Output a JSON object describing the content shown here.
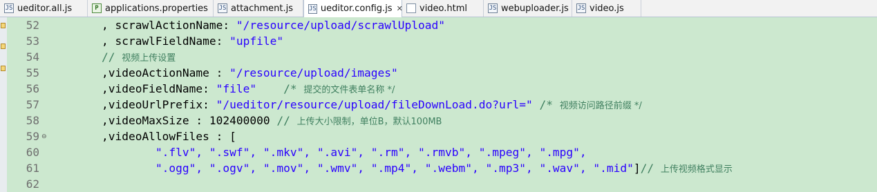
{
  "tabs": [
    {
      "label": "ueditor.all.js",
      "icon": "js-file-icon",
      "glyph": "JS",
      "active": false
    },
    {
      "label": "applications.properties",
      "icon": "properties-file-icon",
      "glyph": "P",
      "active": false
    },
    {
      "label": "attachment.js",
      "icon": "js-file-icon",
      "glyph": "JS",
      "active": false
    },
    {
      "label": "ueditor.config.js",
      "icon": "js-file-icon",
      "glyph": "JS",
      "active": true,
      "close": "✕"
    },
    {
      "label": "video.html",
      "icon": "html-file-icon",
      "glyph": "",
      "active": false
    },
    {
      "label": "webuploader.js",
      "icon": "js-file-icon",
      "glyph": "JS",
      "active": false
    },
    {
      "label": "video.js",
      "icon": "js-file-icon",
      "glyph": "JS",
      "active": false
    }
  ],
  "editor": {
    "lines": [
      {
        "num": "52",
        "a": "        , scrawlActionName: ",
        "s": "\"/resource/upload/scrawlUpload\"",
        "b": "",
        "c": "",
        "z": ""
      },
      {
        "num": "53",
        "a": "        , scrawlFieldName: ",
        "s": "\"upfile\"",
        "b": "",
        "c": "",
        "z": ""
      },
      {
        "num": "54",
        "a": "",
        "s": "",
        "b": "",
        "c": "        // ",
        "z": "视频上传设置"
      },
      {
        "num": "55",
        "a": "        ,videoActionName : ",
        "s": "\"/resource/upload/images\"",
        "b": "",
        "c": "",
        "z": ""
      },
      {
        "num": "56",
        "a": "        ,videoFieldName: ",
        "s": "\"file\"",
        "b": "",
        "c": "    /* ",
        "z": "提交的文件表单名称 */"
      },
      {
        "num": "57",
        "a": "        ,videoUrlPrefix: ",
        "s": "\"/ueditor/resource/upload/fileDownLoad.do?url=\"",
        "b": "",
        "c": " /* ",
        "z": "视频访问路径前缀 */"
      },
      {
        "num": "58",
        "a": "        ,videoMaxSize : 102400000 ",
        "s": "",
        "b": "",
        "c": "// ",
        "z": "上传大小限制，单位B，默认100MB"
      },
      {
        "num": "59",
        "a": "        ,videoAllowFiles : [",
        "s": "",
        "b": "",
        "c": "",
        "z": ""
      },
      {
        "num": "60",
        "a": "                ",
        "s": "\".flv\", \".swf\", \".mkv\", \".avi\", \".rm\", \".rmvb\", \".mpeg\", \".mpg\",",
        "b": "",
        "c": "",
        "z": ""
      },
      {
        "num": "61",
        "a": "                ",
        "s": "\".ogg\", \".ogv\", \".mov\", \".wmv\", \".mp4\", \".webm\", \".mp3\", \".wav\", \".mid\"",
        "b": "]",
        "c": "// ",
        "z": "上传视频格式显示"
      },
      {
        "num": "62",
        "a": "",
        "s": "",
        "b": "",
        "c": "",
        "z": ""
      }
    ],
    "fold_marker": "⊖"
  }
}
